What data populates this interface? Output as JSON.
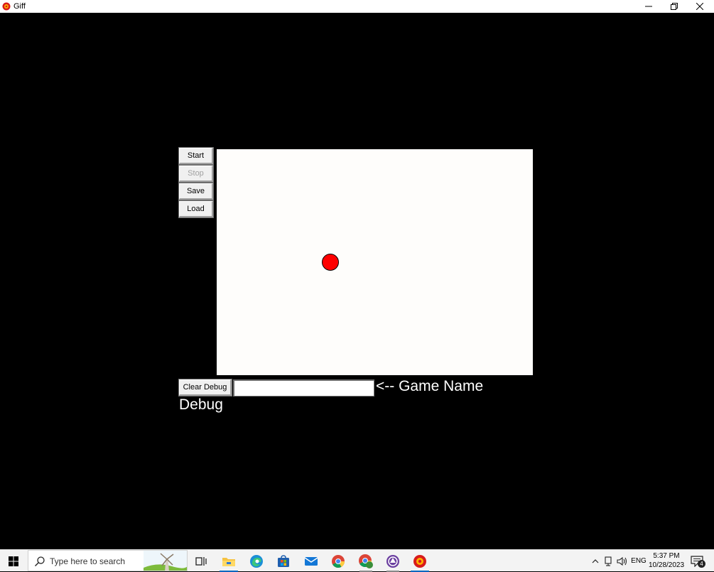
{
  "window": {
    "title": "Giff",
    "icon": "giff-app-icon",
    "controls": {
      "minimize_icon": "minimize-icon",
      "restore_icon": "restore-icon",
      "close_icon": "close-icon"
    }
  },
  "controls": {
    "start_label": "Start",
    "stop_label": "Stop",
    "stop_disabled": true,
    "save_label": "Save",
    "load_label": "Load"
  },
  "canvas": {
    "background": "#fefdfb",
    "ball_color": "#ff0000"
  },
  "debug": {
    "clear_label": "Clear Debug",
    "game_name_value": "",
    "game_name_hint": "<-- Game Name",
    "debug_text": "Debug"
  },
  "taskbar": {
    "search_placeholder": "Type here to search",
    "apps": [
      {
        "name": "task-view-icon"
      },
      {
        "name": "file-explorer-icon"
      },
      {
        "name": "edge-icon"
      },
      {
        "name": "store-icon"
      },
      {
        "name": "mail-icon"
      },
      {
        "name": "chrome-icon"
      },
      {
        "name": "chrome-profile-icon"
      },
      {
        "name": "app-icon"
      },
      {
        "name": "giff-app-icon"
      }
    ],
    "tray": {
      "language": "ENG",
      "time": "5:37 PM",
      "date": "10/28/2023",
      "notification_count": "4"
    }
  }
}
